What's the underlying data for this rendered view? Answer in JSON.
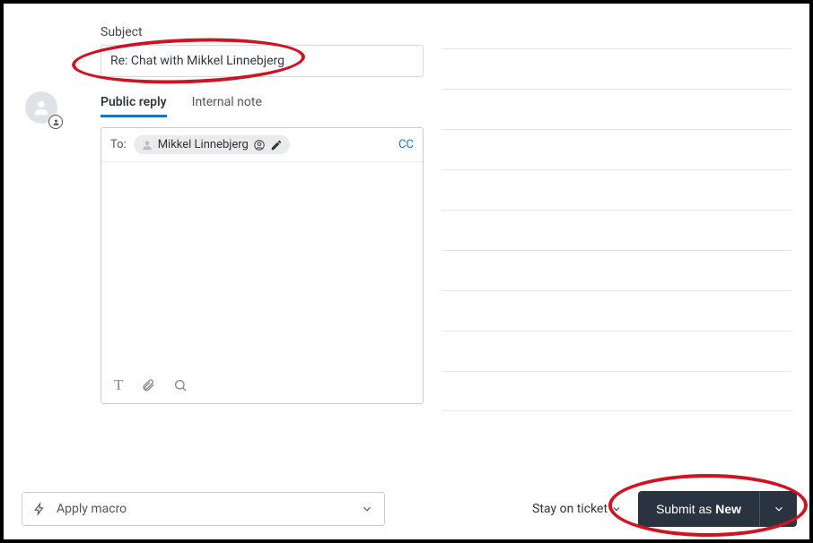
{
  "subject": {
    "label": "Subject",
    "value": "Re: Chat with Mikkel Linnebjerg"
  },
  "tabs": {
    "public_reply": "Public reply",
    "internal_note": "Internal note"
  },
  "reply": {
    "to_label": "To:",
    "recipient": "Mikkel Linnebjerg",
    "cc": "CC"
  },
  "footer": {
    "macro_label": "Apply macro",
    "stay_label": "Stay on ticket",
    "submit_prefix": "Submit as ",
    "submit_status": "New"
  }
}
